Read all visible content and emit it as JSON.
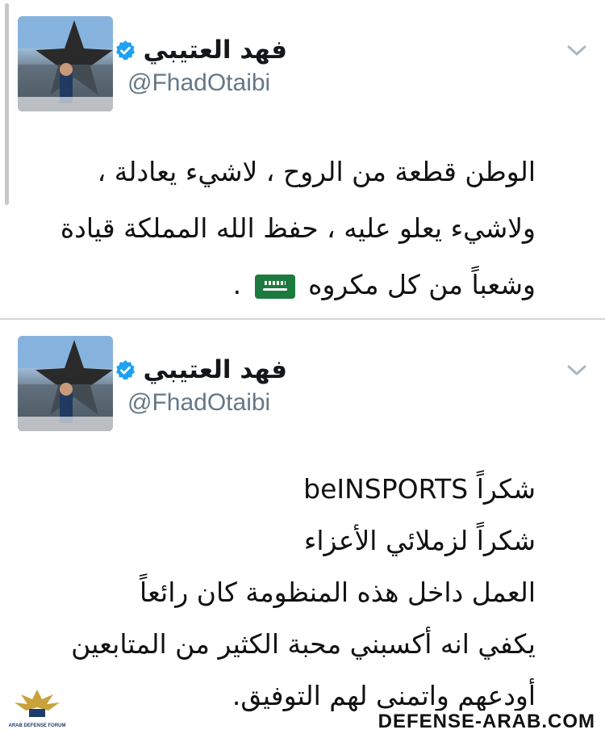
{
  "tweets": [
    {
      "display_name": "فهد العتيبي",
      "handle": "@FhadOtaibi",
      "lines": [
        "الوطن قطعة من الروح ، لاشيء يعادلة ،",
        "ولاشيء يعلو عليه ، حفظ الله المملكة قيادة",
        "وشعباً من كل مكروه",
        "."
      ],
      "icons": [
        "verified-badge-icon",
        "chevron-down-icon",
        "saudi-flag-emoji"
      ]
    },
    {
      "display_name": "فهد العتيبي",
      "handle": "@FhadOtaibi",
      "lines": [
        "شكراً beINSPORTS",
        "شكراً لزملائي الأعزاء",
        "العمل داخل هذه المنظومة كان رائعاً",
        "يكفي انه أكسبني محبة الكثير من المتابعين",
        "أودعهم واتمنى لهم التوفيق."
      ],
      "icons": [
        "verified-badge-icon",
        "chevron-down-icon"
      ]
    }
  ],
  "watermark": {
    "site": "DEFENSE-ARAB.COM",
    "logo_text": "ARAB DEFENSE FORUM"
  },
  "colors": {
    "verified": "#1da1f2",
    "handle": "#657786",
    "separator": "#d6d6d6"
  }
}
